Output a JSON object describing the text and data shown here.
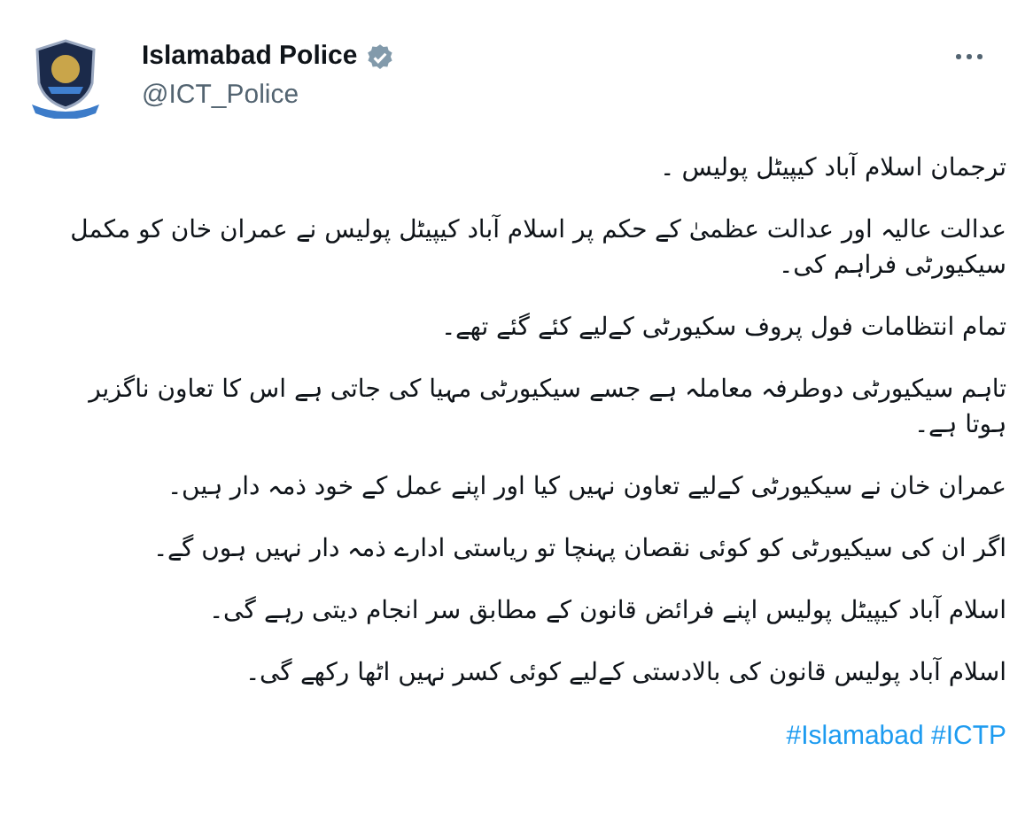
{
  "author": {
    "name": "Islamabad Police",
    "verified": true,
    "handle": "@ICT_Police"
  },
  "paragraphs": [
    "ترجمان اسلام آباد کیپیٹل پولیس ۔",
    "عدالت عالیہ اور عدالت عظمیٰ کے حکم پر اسلام آباد کیپیٹل پولیس نے عمران خان کو مکمل سیکیورٹی فراہم کی۔",
    "تمام انتظامات فول پروف سکیورٹی کےلیے کئے گئے تھے۔",
    "تاہم سیکیورٹی دوطرفہ معاملہ ہے جسے سیکیورٹی مہیا کی جاتی ہے اس کا تعاون ناگزیر ہوتا ہے۔",
    "عمران خان نے سیکیورٹی کےلیے تعاون نہیں کیا اور اپنے عمل کے خود ذمہ دار ہیں۔",
    "اگر ان کی سیکیورٹی کو کوئی نقصان پہنچا تو ریاستی ادارے ذمہ دار نہیں ہوں گے۔",
    "اسلام آباد کیپیٹل پولیس اپنے فرائض قانون کے مطابق سر انجام دیتی رہے گی۔",
    "اسلام آباد پولیس قانون کی بالادستی کےلیے کوئی کسر نہیں اٹھا رکھے گی۔"
  ],
  "hashtags": "#Islamabad #ICTP"
}
